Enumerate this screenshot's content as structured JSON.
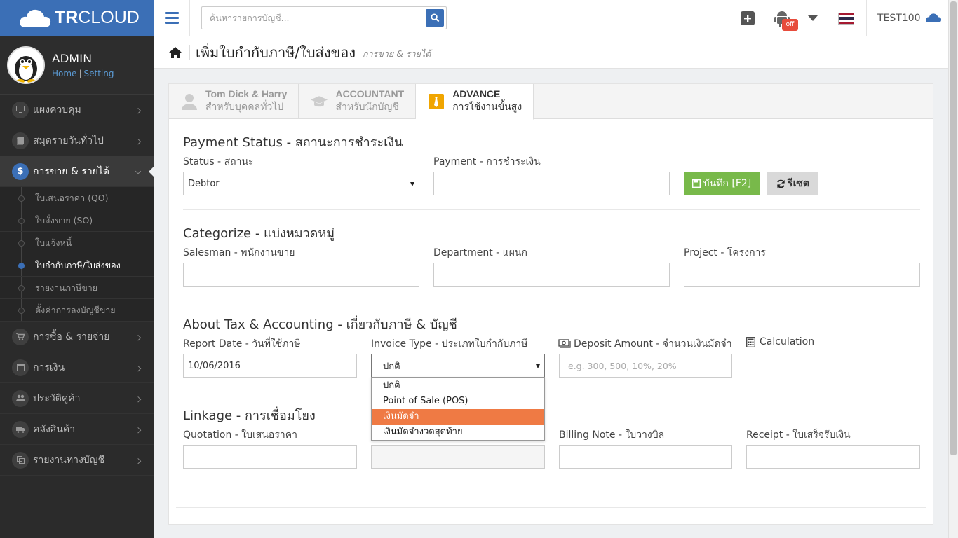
{
  "brand": {
    "name_bold": "TR",
    "name_rest": "CLOUD"
  },
  "search": {
    "placeholder": "ค้นหารายการบัญชี..."
  },
  "header": {
    "badge": "off",
    "username": "TEST100"
  },
  "profile": {
    "name": "ADMIN",
    "home_link": "Home",
    "separator": "|",
    "setting_link": "Setting"
  },
  "sidebar": {
    "items": [
      {
        "label": "แผงควบคุม"
      },
      {
        "label": "สมุดรายวันทั่วไป"
      },
      {
        "label": "การขาย & รายได้"
      },
      {
        "label": "การซื้อ & รายจ่าย"
      },
      {
        "label": "การเงิน"
      },
      {
        "label": "ประวัติคู่ค้า"
      },
      {
        "label": "คลังสินค้า"
      },
      {
        "label": "รายงานทางบัญชี"
      }
    ],
    "sub_items": [
      {
        "label": "ใบเสนอราคา (QO)"
      },
      {
        "label": "ใบสั่งขาย (SO)"
      },
      {
        "label": "ใบแจ้งหนี้"
      },
      {
        "label": "ใบกำกับภาษี/ใบส่งของ"
      },
      {
        "label": "รายงานภาษีขาย"
      },
      {
        "label": "ตั้งค่าการลงบัญชีขาย"
      }
    ],
    "active_icon": "$"
  },
  "page": {
    "title": "เพิ่มใบกำกับภาษี/ใบส่งของ",
    "subtitle": "การขาย & รายได้"
  },
  "tabs": [
    {
      "title": "Tom Dick & Harry",
      "sub": "สำหรับบุคคลทั่วไป"
    },
    {
      "title": "ACCOUNTANT",
      "sub": "สำหรับนักบัญชี"
    },
    {
      "title": "ADVANCE",
      "sub": "การใช้งานขั้นสูง"
    }
  ],
  "payment": {
    "title": "Payment Status - สถานะการชำระเงิน",
    "status_label": "Status - สถานะ",
    "status_value": "Debtor",
    "payment_label": "Payment - การชำระเงิน",
    "payment_value": "",
    "save_label": "บันทึก [F2]",
    "reset_label": "รีเซต"
  },
  "categorize": {
    "title": "Categorize - แบ่งหมวดหมู่",
    "salesman_label": "Salesman - พนักงานขาย",
    "department_label": "Department - แผนก",
    "project_label": "Project - โครงการ"
  },
  "tax": {
    "title": "About Tax & Accounting - เกี่ยวกับภาษี & บัญชี",
    "report_date_label": "Report Date - วันที่ใช้ภาษี",
    "report_date_value": "10/06/2016",
    "invoice_type_label": "Invoice Type - ประเภทใบกำกับภาษี",
    "invoice_type_value": "ปกติ",
    "deposit_label": "Deposit Amount - จำนวนเงินมัดจำ",
    "deposit_placeholder": "e.g. 300, 500, 10%, 20%",
    "calc_label": "Calculation",
    "invoice_options": [
      "ปกติ",
      "Point of Sale (POS)",
      "เงินมัดจำ",
      "เงินมัดจำงวดสุดท้าย"
    ],
    "highlighted_option": "เงินมัดจำ"
  },
  "linkage": {
    "title": "Linkage - การเชื่อมโยง",
    "quotation_label": "Quotation - ใบเสนอราคา",
    "billing_label": "Billing Note - ใบวางบิล",
    "receipt_label": "Receipt - ใบเสร็จรับเงิน"
  },
  "colors": {
    "brand": "#3b6fb6",
    "sidebar": "#2b2b2b",
    "save": "#78b94a",
    "highlight": "#ef7a44",
    "advance_icon": "#f0a500"
  }
}
